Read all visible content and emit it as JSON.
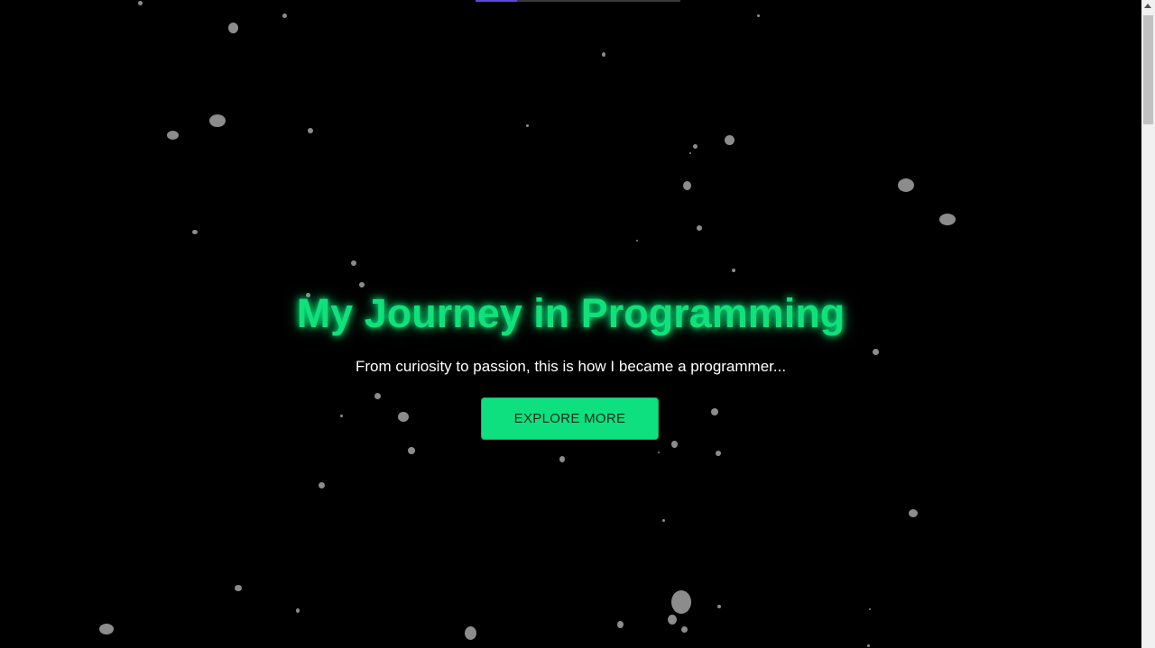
{
  "hero": {
    "title": "My Journey in Programming",
    "subtitle": "From curiosity to passion, this is how I became a programmer...",
    "cta_label": "EXPLORE MORE"
  },
  "colors": {
    "background": "#000000",
    "accent": "#12e07a",
    "button_bg": "#0fe07f",
    "particle": "#8c8c8c"
  },
  "icons": {
    "scroll_up": "chevron-up-icon"
  }
}
